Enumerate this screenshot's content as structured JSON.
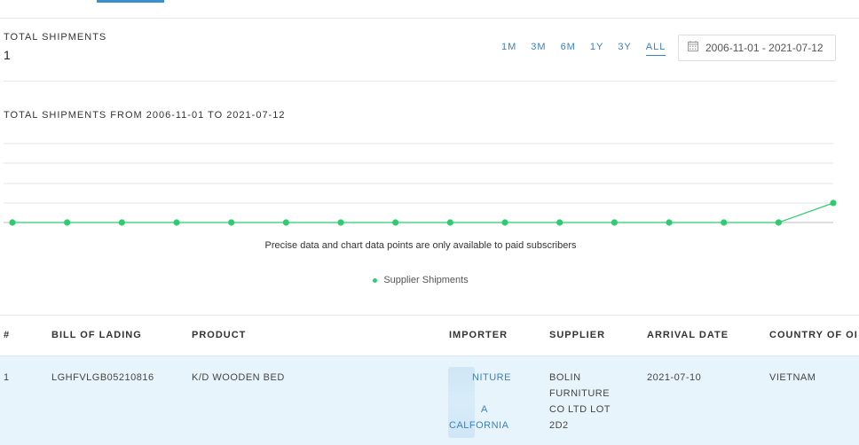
{
  "summary": {
    "label": "TOTAL SHIPMENTS",
    "value": "1"
  },
  "ranges": [
    "1M",
    "3M",
    "6M",
    "1Y",
    "3Y",
    "ALL"
  ],
  "active_range": "ALL",
  "date_range": "2006-11-01 - 2021-07-12",
  "icons": {
    "calendar": "calendar-icon"
  },
  "chart_data": {
    "type": "line",
    "title": "TOTAL SHIPMENTS FROM 2006-11-01 TO 2021-07-12",
    "x": [
      1,
      2,
      3,
      4,
      5,
      6,
      7,
      8,
      9,
      10,
      11,
      12,
      13,
      14,
      15,
      16
    ],
    "series": [
      {
        "name": "Supplier Shipments",
        "values": [
          0,
          0,
          0,
          0,
          0,
          0,
          0,
          0,
          0,
          0,
          0,
          0,
          0,
          0,
          0,
          1
        ]
      }
    ],
    "ylim": [
      0,
      5
    ],
    "grid": true,
    "color": "#2ecc71"
  },
  "notice": "Precise data and chart data points are only available to paid subscribers",
  "table": {
    "headers": [
      "#",
      "BILL OF LADING",
      "PRODUCT",
      "IMPORTER",
      "SUPPLIER",
      "ARRIVAL DATE",
      "COUNTRY OF OI"
    ],
    "row": {
      "index": "1",
      "bill_of_lading": "LGHFVLGB05210816",
      "product": "K/D WOODEN BED",
      "importer_lines": [
        "NITURE",
        "",
        "A",
        "CALFORNIA"
      ],
      "supplier_lines": [
        "BOLIN",
        "FURNITURE",
        "CO LTD LOT",
        "2D2"
      ],
      "arrival_date": "2021-07-10",
      "country": "VIETNAM"
    }
  }
}
